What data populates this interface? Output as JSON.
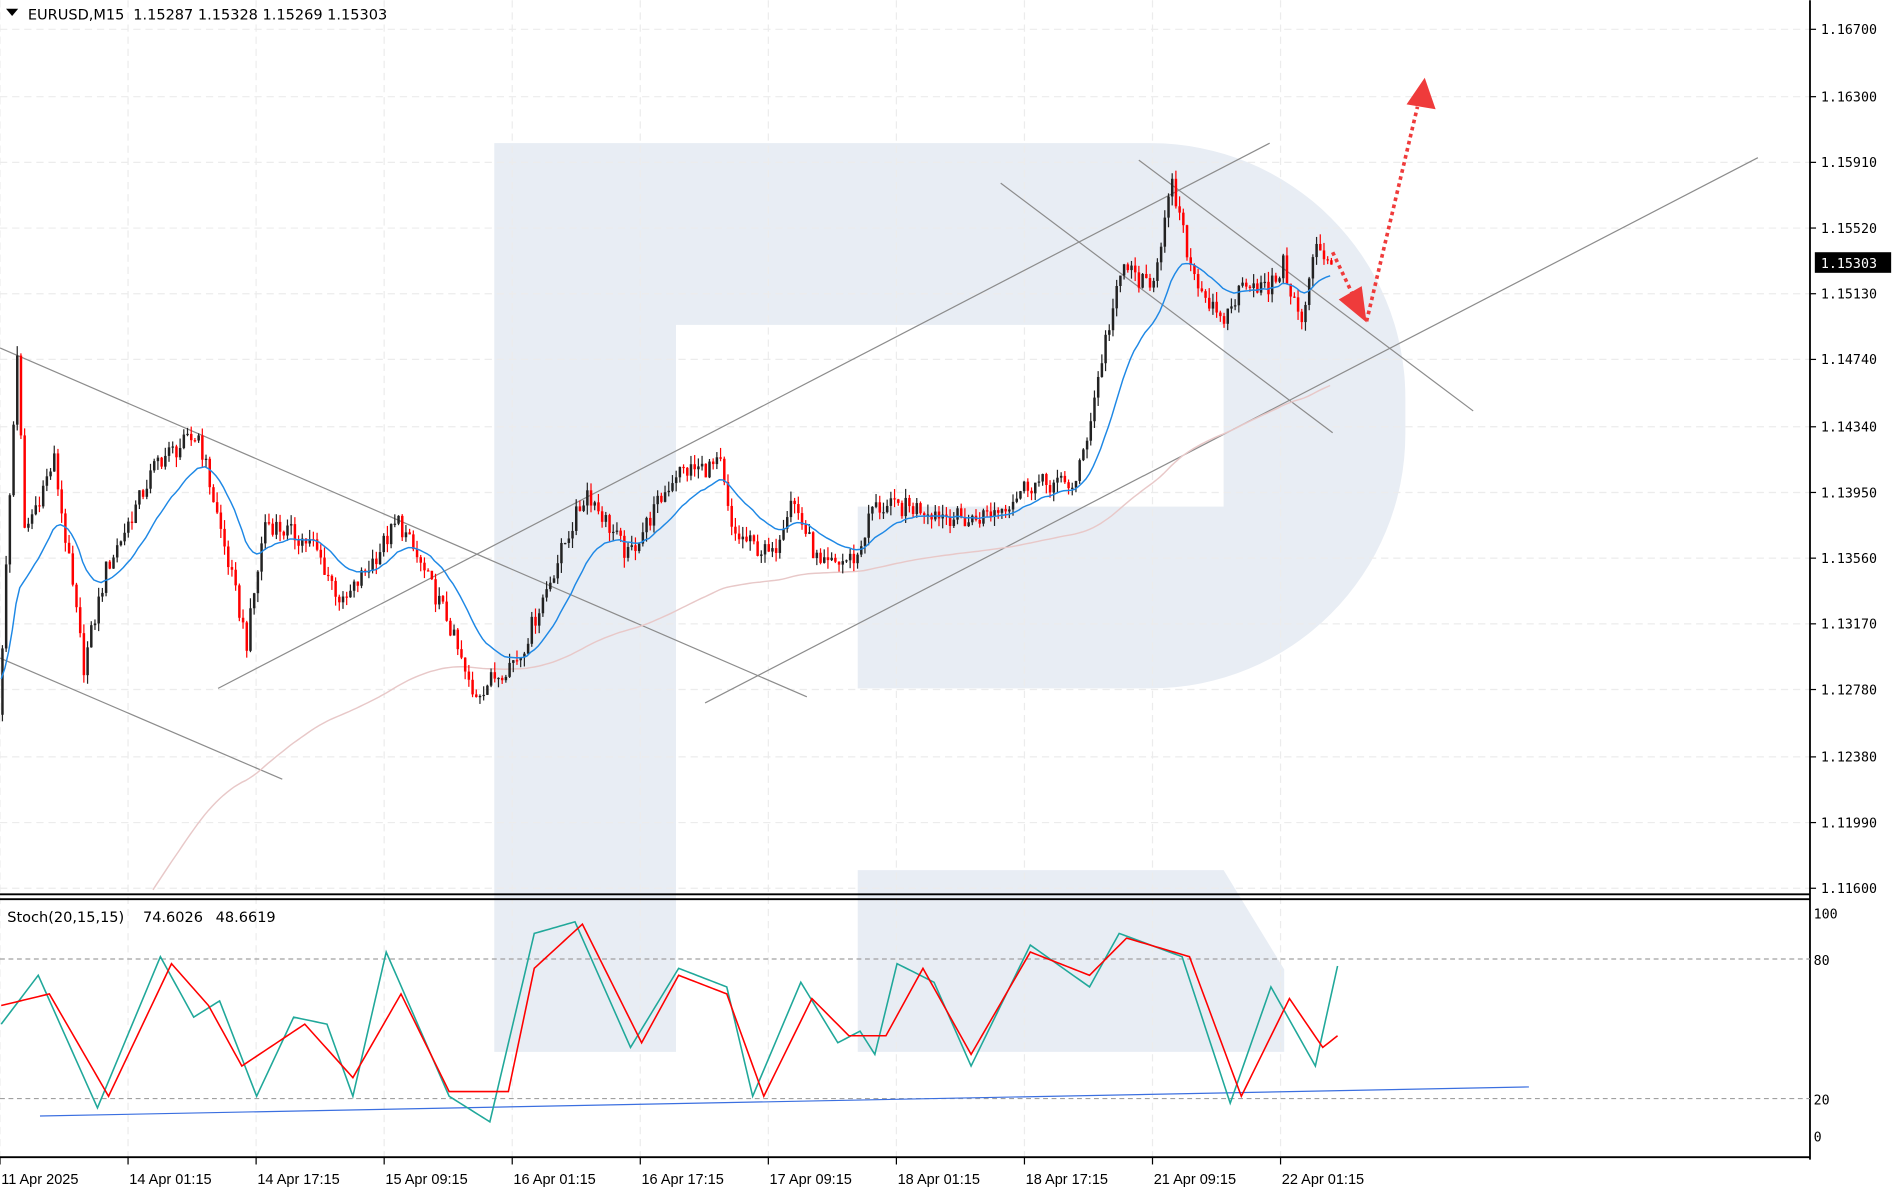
{
  "header": {
    "symbol": "EURUSD,M15",
    "ohlc": "1.15287 1.15328 1.15269 1.15303"
  },
  "chart_data": {
    "type": "candlestick",
    "symbol": "EURUSD",
    "timeframe": "M15",
    "ylim": [
      1.116,
      1.167
    ],
    "yticks": [
      "1.16700",
      "1.16300",
      "1.15910",
      "1.15520",
      "1.15130",
      "1.14740",
      "1.14340",
      "1.13950",
      "1.13560",
      "1.13170",
      "1.12780",
      "1.12380",
      "1.11990",
      "1.11600"
    ],
    "current_price": "1.15303",
    "xticks": [
      "11 Apr 2025",
      "14 Apr 01:15",
      "14 Apr 17:15",
      "15 Apr 09:15",
      "16 Apr 01:15",
      "16 Apr 17:15",
      "17 Apr 09:15",
      "18 Apr 01:15",
      "18 Apr 17:15",
      "21 Apr 09:15",
      "22 Apr 01:15"
    ],
    "bars": 360,
    "close_path": [
      [
        0,
        1.1263
      ],
      [
        5,
        1.1479
      ],
      [
        7,
        1.1371
      ],
      [
        15,
        1.1414
      ],
      [
        23,
        1.1292
      ],
      [
        29,
        1.1349
      ],
      [
        43,
        1.1414
      ],
      [
        54,
        1.1429
      ],
      [
        67,
        1.1306
      ],
      [
        72,
        1.1378
      ],
      [
        85,
        1.1364
      ],
      [
        93,
        1.1328
      ],
      [
        108,
        1.1378
      ],
      [
        121,
        1.1321
      ],
      [
        128,
        1.1274
      ],
      [
        141,
        1.1299
      ],
      [
        154,
        1.1371
      ],
      [
        159,
        1.1396
      ],
      [
        170,
        1.1357
      ],
      [
        183,
        1.1407
      ],
      [
        195,
        1.1411
      ],
      [
        198,
        1.1371
      ],
      [
        209,
        1.1357
      ],
      [
        214,
        1.1393
      ],
      [
        222,
        1.135
      ],
      [
        232,
        1.1357
      ],
      [
        236,
        1.1386
      ],
      [
        249,
        1.1386
      ],
      [
        262,
        1.1378
      ],
      [
        271,
        1.1386
      ],
      [
        278,
        1.14
      ],
      [
        291,
        1.14
      ],
      [
        294,
        1.1429
      ],
      [
        299,
        1.1486
      ],
      [
        304,
        1.153
      ],
      [
        311,
        1.1515
      ],
      [
        317,
        1.1576
      ],
      [
        322,
        1.153
      ],
      [
        330,
        1.1494
      ],
      [
        337,
        1.1522
      ],
      [
        343,
        1.1515
      ],
      [
        347,
        1.153
      ],
      [
        352,
        1.1494
      ],
      [
        356,
        1.1544
      ],
      [
        360,
        1.153
      ]
    ],
    "ma_fast_period": 20,
    "ma_slow_period": 150,
    "stoch": {
      "label": "Stoch(20,15,15)",
      "k_value": "74.6026",
      "d_value": "48.6619",
      "levels": [
        "100",
        "80",
        "20",
        "0"
      ],
      "k_path": [
        [
          0,
          52
        ],
        [
          10,
          73
        ],
        [
          26,
          16
        ],
        [
          43,
          81
        ],
        [
          52,
          55
        ],
        [
          59,
          62
        ],
        [
          69,
          21
        ],
        [
          79,
          55
        ],
        [
          88,
          52
        ],
        [
          95,
          21
        ],
        [
          104,
          83
        ],
        [
          121,
          21
        ],
        [
          132,
          10
        ],
        [
          144,
          91
        ],
        [
          155,
          96
        ],
        [
          170,
          42
        ],
        [
          183,
          76
        ],
        [
          196,
          68
        ],
        [
          203,
          21
        ],
        [
          216,
          70
        ],
        [
          226,
          44
        ],
        [
          232,
          49
        ],
        [
          236,
          39
        ],
        [
          242,
          78
        ],
        [
          252,
          70
        ],
        [
          262,
          34
        ],
        [
          278,
          86
        ],
        [
          294,
          68
        ],
        [
          302,
          91
        ],
        [
          319,
          81
        ],
        [
          332,
          18
        ],
        [
          343,
          68
        ],
        [
          355,
          34
        ],
        [
          361,
          77
        ]
      ],
      "d_path": [
        [
          0,
          60
        ],
        [
          13,
          65
        ],
        [
          29,
          21
        ],
        [
          46,
          78
        ],
        [
          56,
          60
        ],
        [
          65,
          34
        ],
        [
          82,
          52
        ],
        [
          95,
          29
        ],
        [
          108,
          65
        ],
        [
          121,
          23
        ],
        [
          137,
          23
        ],
        [
          144,
          76
        ],
        [
          157,
          95
        ],
        [
          173,
          44
        ],
        [
          183,
          73
        ],
        [
          196,
          65
        ],
        [
          206,
          21
        ],
        [
          219,
          63
        ],
        [
          229,
          47
        ],
        [
          239,
          47
        ],
        [
          249,
          76
        ],
        [
          262,
          39
        ],
        [
          278,
          83
        ],
        [
          294,
          73
        ],
        [
          304,
          89
        ],
        [
          321,
          81
        ],
        [
          335,
          21
        ],
        [
          348,
          63
        ],
        [
          357,
          42
        ],
        [
          361,
          47
        ]
      ]
    },
    "colors": {
      "bull": "#222222",
      "bear": "#ff0000",
      "ma_fast": "#1e88e5",
      "ma_slow": "#e8c8c8",
      "stoch_k": "#20a89a",
      "stoch_d": "#ff0000",
      "trend": "#8c8c8c",
      "stoch_trend": "#3b6fe0",
      "arrow": "#ef3b3b",
      "watermark": "#e8edf4"
    }
  }
}
